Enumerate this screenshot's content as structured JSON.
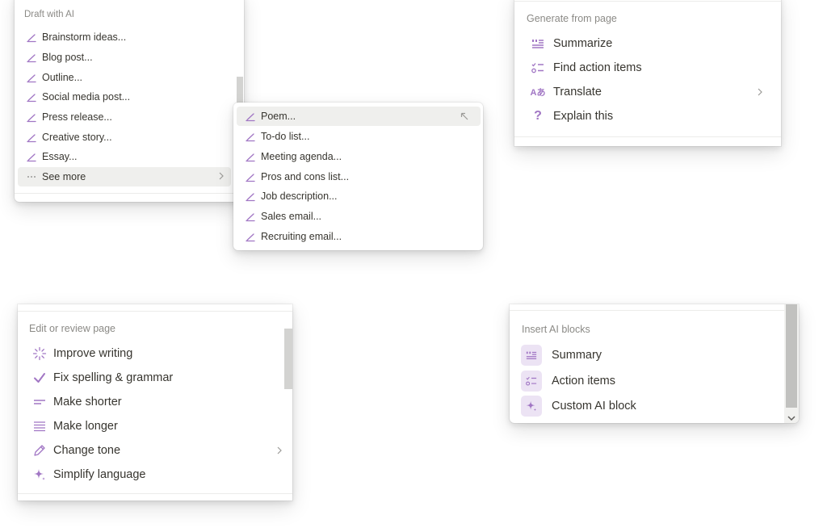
{
  "draft_menu": {
    "heading": "Draft with AI",
    "items": [
      {
        "label": "Brainstorm ideas...",
        "icon": "pencil-icon"
      },
      {
        "label": "Blog post...",
        "icon": "pencil-icon"
      },
      {
        "label": "Outline...",
        "icon": "pencil-icon"
      },
      {
        "label": "Social media post...",
        "icon": "pencil-icon"
      },
      {
        "label": "Press release...",
        "icon": "pencil-icon"
      },
      {
        "label": "Creative story...",
        "icon": "pencil-icon"
      },
      {
        "label": "Essay...",
        "icon": "pencil-icon"
      }
    ],
    "see_more": {
      "label": "See more",
      "icon": "ellipsis-icon"
    }
  },
  "submenu": {
    "items": [
      {
        "label": "Poem...",
        "icon": "pencil-icon"
      },
      {
        "label": "To-do list...",
        "icon": "pencil-icon"
      },
      {
        "label": "Meeting agenda...",
        "icon": "pencil-icon"
      },
      {
        "label": "Pros and cons list...",
        "icon": "pencil-icon"
      },
      {
        "label": "Job description...",
        "icon": "pencil-icon"
      },
      {
        "label": "Sales email...",
        "icon": "pencil-icon"
      },
      {
        "label": "Recruiting email...",
        "icon": "pencil-icon"
      }
    ]
  },
  "generate_menu": {
    "heading": "Generate from page",
    "items": [
      {
        "label": "Summarize",
        "icon": "summary-icon"
      },
      {
        "label": "Find action items",
        "icon": "checklist-icon"
      },
      {
        "label": "Translate",
        "icon": "translate-icon"
      },
      {
        "label": "Explain this",
        "icon": "question-icon"
      }
    ],
    "translate_glyph": "Aあ"
  },
  "edit_menu": {
    "heading": "Edit or review page",
    "items": [
      {
        "label": "Improve writing",
        "icon": "sparkle-burst-icon"
      },
      {
        "label": "Fix spelling & grammar",
        "icon": "checkmark-icon"
      },
      {
        "label": "Make shorter",
        "icon": "short-lines-icon"
      },
      {
        "label": "Make longer",
        "icon": "long-lines-icon"
      },
      {
        "label": "Change tone",
        "icon": "pen-icon"
      },
      {
        "label": "Simplify language",
        "icon": "sparkle-icon"
      }
    ]
  },
  "insert_menu": {
    "heading": "Insert AI blocks",
    "items": [
      {
        "label": "Summary",
        "icon": "summary-icon"
      },
      {
        "label": "Action items",
        "icon": "checklist-icon"
      },
      {
        "label": "Custom AI block",
        "icon": "sparkle-icon"
      }
    ]
  },
  "colors": {
    "accent": "#a176c4",
    "text": "#37352f",
    "muted": "#8b8a86",
    "hover": "#efefed",
    "tile": "#ece3f4"
  }
}
